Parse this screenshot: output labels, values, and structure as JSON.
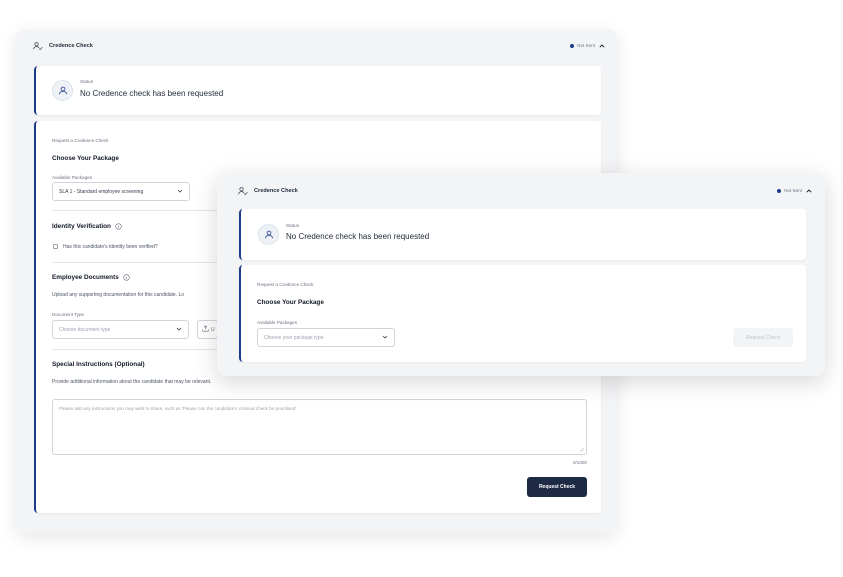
{
  "back": {
    "header": {
      "title": "Credence Check",
      "status": "Not Sent"
    },
    "status_card": {
      "label": "Status",
      "message": "No Credence check has been requested"
    },
    "form": {
      "eyebrow": "Request a Credence Check",
      "package_heading": "Choose Your Package",
      "packages_label": "Available Packages",
      "packages_value": "SLA 1 - Standard employee screening",
      "identity_heading": "Identity Verification",
      "identity_checkbox": "Has this candidate's identity been verified?",
      "documents_heading": "Employee Documents",
      "documents_desc": "Upload any supporting documentation for this candidate. Lo",
      "doc_type_label": "Document Type",
      "doc_type_placeholder": "Choose document type",
      "upload_label": "U",
      "special_heading": "Special Instructions (Optional)",
      "special_desc": "Provide additional information about the candidate that may be relevant.",
      "textarea_placeholder": "Please add any instructions you may wish to share, such as 'Please can the candidate's criminal check be prioritised'",
      "char_count": "0/1000",
      "submit": "Request Check"
    }
  },
  "front": {
    "header": {
      "title": "Credence Check",
      "status": "Not Sent"
    },
    "status_card": {
      "label": "Status",
      "message": "No Credence check has been requested"
    },
    "form": {
      "eyebrow": "Request a Credence Check",
      "package_heading": "Choose Your Package",
      "packages_label": "Available Packages",
      "packages_placeholder": "Choose your package type",
      "submit": "Request Check"
    }
  },
  "icons": {
    "user_check": "user-check-icon",
    "caret_up": "chevron-up-icon",
    "chevron_down": "chevron-down-icon",
    "info": "info-icon",
    "person": "person-icon",
    "upload": "upload-icon"
  },
  "colors": {
    "accent": "#1e3a8a",
    "primary_button": "#1e2a44",
    "panel_bg": "#f3f4f6"
  }
}
